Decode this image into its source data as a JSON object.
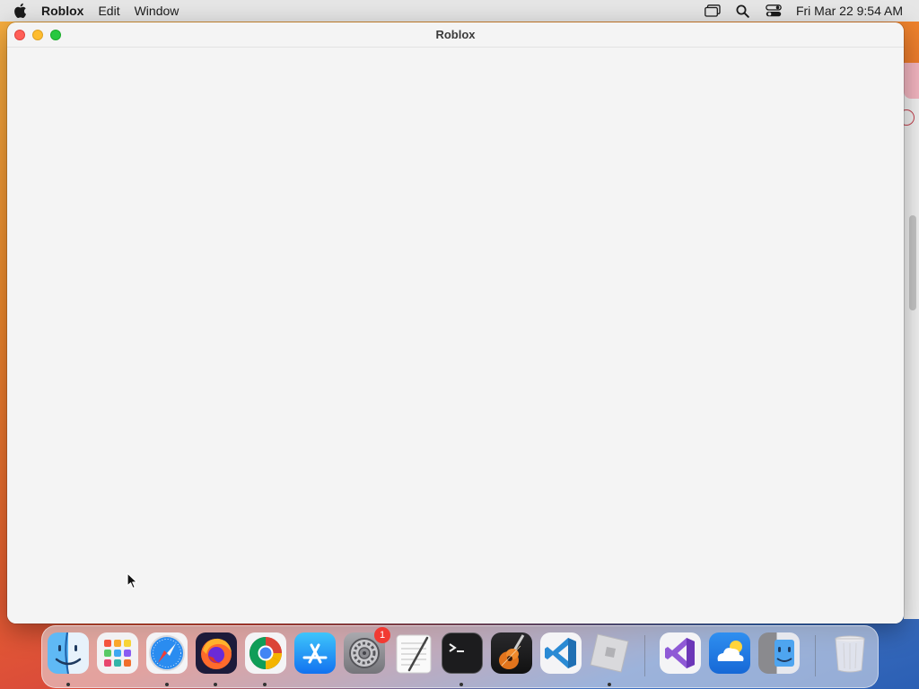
{
  "menubar": {
    "app_name": "Roblox",
    "menus": [
      "Edit",
      "Window"
    ],
    "clock": "Fri Mar 22  9:54 AM"
  },
  "window": {
    "title": "Roblox"
  },
  "dock": {
    "items": [
      {
        "name": "finder-icon",
        "running": true
      },
      {
        "name": "launchpad-icon",
        "running": false
      },
      {
        "name": "safari-icon",
        "running": true
      },
      {
        "name": "firefox-icon",
        "running": true
      },
      {
        "name": "chrome-icon",
        "running": true
      },
      {
        "name": "app-store-icon",
        "running": false
      },
      {
        "name": "system-settings-icon",
        "running": false,
        "badge": "1"
      },
      {
        "name": "textedit-icon",
        "running": false
      },
      {
        "name": "terminal-icon",
        "running": true
      },
      {
        "name": "garageband-icon",
        "running": false
      },
      {
        "name": "vscode-icon",
        "running": false
      },
      {
        "name": "roblox-icon",
        "running": true
      },
      {
        "name": "visual-studio-icon",
        "running": false
      },
      {
        "name": "onedrive-icon",
        "running": false
      },
      {
        "name": "finder-alt-icon",
        "running": false
      },
      {
        "name": "trash-icon",
        "running": false
      }
    ],
    "badge_settings": "1"
  },
  "colors": {
    "close": "#ff5f57",
    "minimize": "#febc2e",
    "maximize": "#28c840",
    "badge": "#f23a32"
  }
}
